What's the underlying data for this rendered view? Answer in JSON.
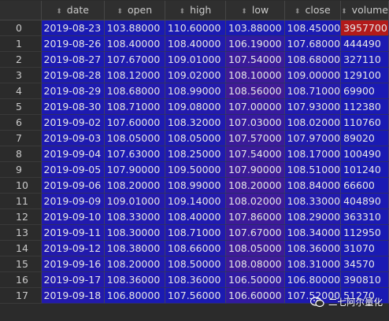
{
  "table": {
    "columns": [
      "date",
      "open",
      "high",
      "low",
      "close",
      "volume"
    ],
    "rows": [
      {
        "index": "0",
        "values": [
          "2019-08-23",
          "103.88000",
          "110.60000",
          "103.88000",
          "108.45000",
          "3957700"
        ],
        "colors": [
          "#1a1ab3",
          "#1a1ab3",
          "#1a1ab3",
          "#1a1ab3",
          "#1a1ab3",
          "#b21a1a"
        ]
      },
      {
        "index": "1",
        "values": [
          "2019-08-26",
          "108.40000",
          "108.40000",
          "106.19000",
          "107.68000",
          "444490"
        ],
        "colors": [
          "#1a1ab3",
          "#1f1ab0",
          "#211aae",
          "#2f1aa3",
          "#1f1ab0",
          "#1c1ab2"
        ]
      },
      {
        "index": "2",
        "values": [
          "2019-08-27",
          "107.67000",
          "109.01000",
          "107.54000",
          "108.68000",
          "327110"
        ],
        "colors": [
          "#1c1ab2",
          "#1f1ab0",
          "#221aad",
          "#3a1a9a",
          "#241aab",
          "#1b1ab2"
        ]
      },
      {
        "index": "3",
        "values": [
          "2019-08-28",
          "108.12000",
          "109.02000",
          "108.10000",
          "109.00000",
          "129100"
        ],
        "colors": [
          "#1c1ab2",
          "#1f1ab0",
          "#221aad",
          "#3e1a97",
          "#261aaa",
          "#1a1ab3"
        ]
      },
      {
        "index": "4",
        "values": [
          "2019-08-29",
          "108.68000",
          "108.99000",
          "108.56000",
          "108.71000",
          "69900"
        ],
        "colors": [
          "#1d1ab1",
          "#221aad",
          "#221aad",
          "#401a95",
          "#241aab",
          "#1a1ab3"
        ]
      },
      {
        "index": "5",
        "values": [
          "2019-08-30",
          "108.71000",
          "109.08000",
          "107.00000",
          "107.93000",
          "112380"
        ],
        "colors": [
          "#1d1ab1",
          "#221aad",
          "#221aad",
          "#361a9e",
          "#201aaf",
          "#1a1ab3"
        ]
      },
      {
        "index": "6",
        "values": [
          "2019-09-02",
          "107.60000",
          "108.32000",
          "107.03000",
          "108.02000",
          "110760"
        ],
        "colors": [
          "#1e1ab0",
          "#1c1ab2",
          "#1f1ab0",
          "#361a9e",
          "#211aae",
          "#1a1ab3"
        ]
      },
      {
        "index": "7",
        "values": [
          "2019-09-03",
          "108.05000",
          "108.05000",
          "107.57000",
          "107.97000",
          "89020"
        ],
        "colors": [
          "#1e1ab0",
          "#1f1ab0",
          "#1e1ab0",
          "#3a1a9a",
          "#211aae",
          "#1a1ab3"
        ]
      },
      {
        "index": "8",
        "values": [
          "2019-09-04",
          "107.63000",
          "108.25000",
          "107.54000",
          "108.17000",
          "100490"
        ],
        "colors": [
          "#1f1ab0",
          "#1c1ab2",
          "#1f1ab0",
          "#3a1a9a",
          "#221aad",
          "#1a1ab3"
        ]
      },
      {
        "index": "9",
        "values": [
          "2019-09-05",
          "107.90000",
          "109.50000",
          "107.90000",
          "108.51000",
          "101240"
        ],
        "colors": [
          "#1f1ab0",
          "#1e1ab0",
          "#241aab",
          "#3c1a98",
          "#231aac",
          "#1a1ab3"
        ]
      },
      {
        "index": "10",
        "values": [
          "2019-09-06",
          "108.20000",
          "108.99000",
          "108.20000",
          "108.84000",
          "66600"
        ],
        "colors": [
          "#201aaf",
          "#201aaf",
          "#221aad",
          "#3e1a97",
          "#251aab",
          "#1a1ab3"
        ]
      },
      {
        "index": "11",
        "values": [
          "2019-09-09",
          "109.01000",
          "109.14000",
          "108.02000",
          "108.33000",
          "404890"
        ],
        "colors": [
          "#201aaf",
          "#241aab",
          "#221aad",
          "#3d1a98",
          "#221aad",
          "#1c1ab2"
        ]
      },
      {
        "index": "12",
        "values": [
          "2019-09-10",
          "108.33000",
          "108.40000",
          "107.86000",
          "108.29000",
          "363310"
        ],
        "colors": [
          "#211aae",
          "#201aaf",
          "#1f1ab0",
          "#3c1a98",
          "#221aad",
          "#1b1ab2"
        ]
      },
      {
        "index": "13",
        "values": [
          "2019-09-11",
          "108.30000",
          "108.71000",
          "107.67000",
          "108.34000",
          "112950"
        ],
        "colors": [
          "#211aae",
          "#201aaf",
          "#211aae",
          "#3a1a9a",
          "#221aad",
          "#1a1ab3"
        ]
      },
      {
        "index": "14",
        "values": [
          "2019-09-12",
          "108.38000",
          "108.66000",
          "108.05000",
          "108.36000",
          "31070"
        ],
        "colors": [
          "#221aad",
          "#211aae",
          "#201aaf",
          "#3d1a98",
          "#221aad",
          "#1a1ab3"
        ]
      },
      {
        "index": "15",
        "values": [
          "2019-09-16",
          "108.20000",
          "108.50000",
          "108.08000",
          "108.31000",
          "34570"
        ],
        "colors": [
          "#221aad",
          "#201aaf",
          "#201aaf",
          "#3d1a98",
          "#221aad",
          "#1a1ab3"
        ]
      },
      {
        "index": "16",
        "values": [
          "2019-09-17",
          "108.36000",
          "108.36000",
          "106.50000",
          "106.80000",
          "390810"
        ],
        "colors": [
          "#231aac",
          "#211aae",
          "#1f1ab0",
          "#311aa2",
          "#1a1ab3",
          "#1b1ab2"
        ]
      },
      {
        "index": "17",
        "values": [
          "2019-09-18",
          "106.80000",
          "107.56000",
          "106.60000",
          "107.52000",
          "51270"
        ],
        "colors": [
          "#231aac",
          "#1a1ab3",
          "#1b1ab2",
          "#321aa1",
          "#1e1ab0",
          "#1a1ab3"
        ]
      }
    ]
  },
  "watermark": {
    "text": "二七阿尔量化",
    "icon": "wechat-icon"
  }
}
